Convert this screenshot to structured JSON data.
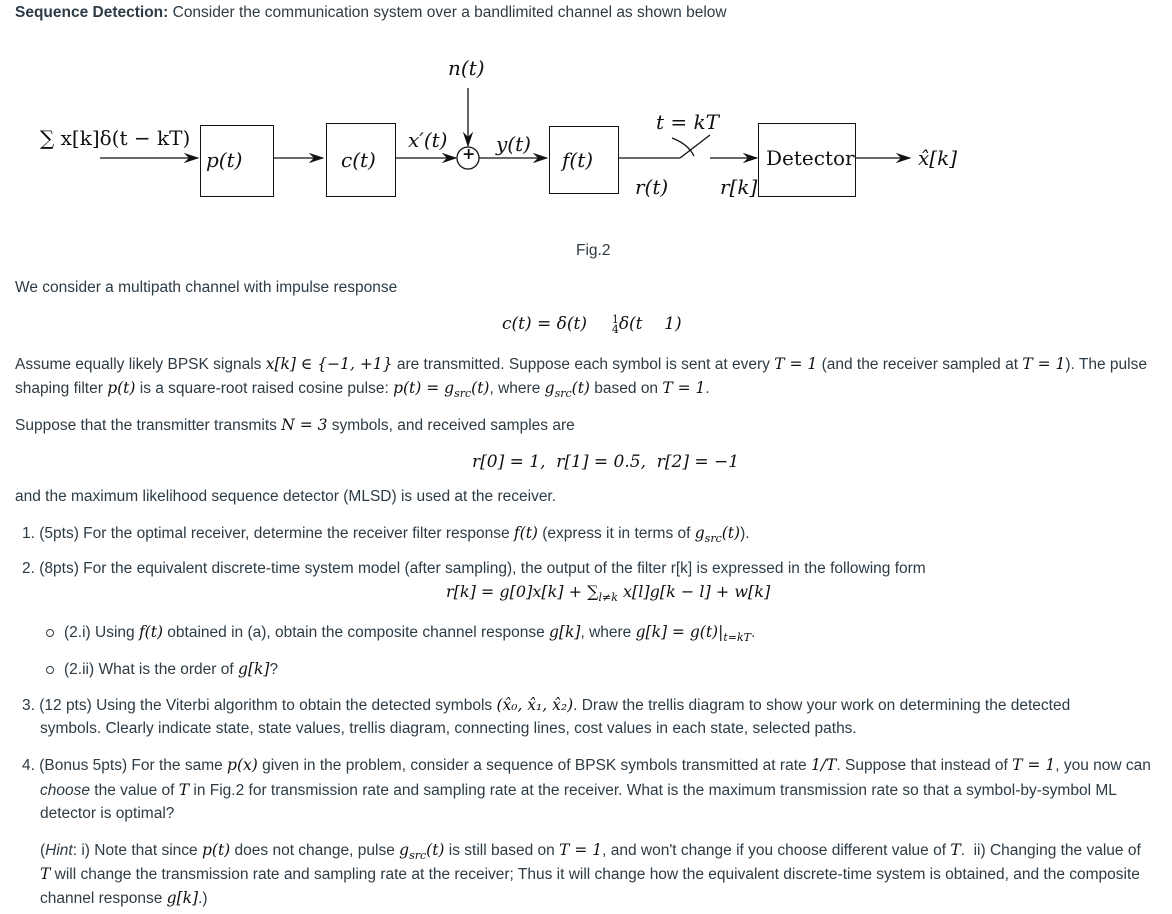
{
  "header": {
    "title_bold": "Sequence Detection:",
    "title_rest": " Consider the communication system over a bandlimited channel as shown below"
  },
  "diagram": {
    "input_label": "∑ x[k]δ(t − kT)",
    "block_p": "p(t)",
    "block_c": "c(t)",
    "signal_xprime": "x′(t)",
    "noise_label": "n(t)",
    "adder_symbol": "+",
    "signal_y": "y(t)",
    "block_f": "f(t)",
    "signal_r_t": "r(t)",
    "sampler_label": "t = kT",
    "signal_r_k": "r[k]",
    "block_detector": "Detector",
    "output_label": "x̂[k]",
    "caption": "Fig.2"
  },
  "body": {
    "channel_intro": "We consider a multipath channel with impulse response",
    "channel_eq_left": "c(t) = δ(t)",
    "channel_eq_frac_num": "1",
    "channel_eq_frac_den": "4",
    "channel_eq_right": "δ(t    1)",
    "assume_line1_a": "Assume equally likely BPSK signals ",
    "assume_line1_math1": "x[k] ∈ {−1, +1}",
    "assume_line1_b": " are transmitted. Suppose each symbol is sent at every ",
    "assume_line1_math2": "T = 1",
    "assume_line1_c": " (and the receiver sampled at ",
    "assume_line1_math3": "T = 1",
    "assume_line1_d": "). The pulse",
    "assume_line2_a": "shaping filter ",
    "assume_line2_math1": "p(t)",
    "assume_line2_b": " is a square-root raised cosine pulse: ",
    "assume_line2_math2": "p(t) = g",
    "assume_line2_sub": "src",
    "assume_line2_math2b": "(t)",
    "assume_line2_c": ", where ",
    "assume_line2_math3": "g",
    "assume_line2_math3b": "(t)",
    "assume_line2_d": " based on ",
    "assume_line2_math4": "T = 1",
    "assume_line2_e": ".",
    "suppose_a": "Suppose that the transmitter transmits ",
    "suppose_math": "N = 3",
    "suppose_b": " symbols, and received samples are",
    "samples_eq": "r[0] = 1,  r[1] = 0.5,  r[2] = −1",
    "mlsd_line": "and the maximum likelihood sequence detector (MLSD) is used at the receiver."
  },
  "questions": {
    "q1_a": "1. (5pts) For the optimal receiver, determine the receiver filter response ",
    "q1_math": "f(t)",
    "q1_b": " (express it in terms of ",
    "q1_math2": "g",
    "q1_sub": "src",
    "q1_math2b": "(t)",
    "q1_c": ").",
    "q2": "2. (8pts) For the equivalent discrete-time system model (after sampling), the output of the filter r[k] is expressed in the following form",
    "q2_eq_a": "r[k] = g[0]x[k] + ∑",
    "q2_eq_sub": "l≠k",
    "q2_eq_b": " x[l]g[k − l] + w[k]",
    "q2i_a": "(2.i) Using ",
    "q2i_math1": "f(t)",
    "q2i_b": " obtained in (a), obtain the composite channel response ",
    "q2i_math2": "g[k]",
    "q2i_c": ", where ",
    "q2i_math3": "g[k] = g(t)|",
    "q2i_sub": "t=kT",
    "q2i_d": ".",
    "q2ii_a": "(2.ii) What is the order of ",
    "q2ii_math": "g[k]",
    "q2ii_b": "?",
    "q3_line1_a": "3. (12 pts) Using the Viterbi algorithm to obtain the detected symbols ",
    "q3_line1_math": "(x̂₀, x̂₁, x̂₂)",
    "q3_line1_b": ". Draw the trellis diagram to show your work on determining the detected",
    "q3_line2": "symbols. Clearly indicate state, state values, trellis diagram, connecting lines, cost values in each state, selected paths.",
    "q4_line1_a": "4. (Bonus 5pts) For the same ",
    "q4_line1_math1": "p(x)",
    "q4_line1_b": " given in the problem, consider a sequence of BPSK symbols transmitted at rate ",
    "q4_line1_math2": "1/T",
    "q4_line1_c": ". Suppose that instead of ",
    "q4_line1_math3": "T = 1",
    "q4_line1_d": ", you now can",
    "q4_line2_em": "choose",
    "q4_line2_a": " the value of ",
    "q4_line2_math": "T",
    "q4_line2_b": " in Fig.2 for transmission rate and sampling rate at the receiver. What is the maximum transmission rate so that a symbol-by-symbol ML",
    "q4_line3": "detector is optimal?",
    "hint_line1_a": "(",
    "hint_line1_em": "Hint",
    "hint_line1_b": ": i) Note that since ",
    "hint_line1_math1": "p(t)",
    "hint_line1_c": " does not change, pulse ",
    "hint_line1_math2": "g",
    "hint_line1_sub": "src",
    "hint_line1_math2b": "(t)",
    "hint_line1_d": " is still based on ",
    "hint_line1_math3": "T = 1",
    "hint_line1_e": ", and won't change if you choose different value of ",
    "hint_line1_math4": "T",
    "hint_line1_f": ".  ii) Changing the value of",
    "hint_line2_math": "T",
    "hint_line2_a": " will change the transmission rate and sampling rate at the receiver; Thus it will change how the equivalent discrete-time system is obtained, and the composite",
    "hint_line3_a": "channel response ",
    "hint_line3_math": "g[k]",
    "hint_line3_b": ".)"
  }
}
